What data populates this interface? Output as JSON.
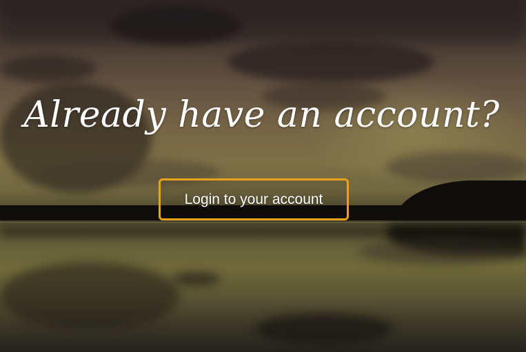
{
  "hero": {
    "heading": "Already have an account?",
    "button_label": "Login to your account"
  },
  "colors": {
    "accent_border": "#e9a21a",
    "text": "#ffffff"
  }
}
